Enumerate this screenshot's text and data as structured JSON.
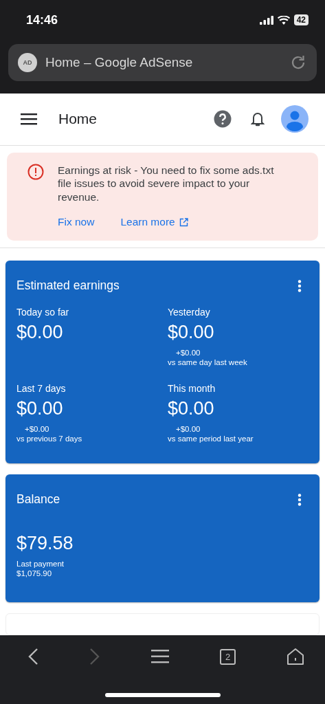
{
  "status_bar": {
    "time": "14:46",
    "battery": "42"
  },
  "browser": {
    "site_badge": "AD",
    "title": "Home – Google AdSense"
  },
  "app_bar": {
    "title": "Home"
  },
  "alert": {
    "message": "Earnings at risk - You need to fix some ads.txt file issues to avoid severe impact to your revenue.",
    "actions": [
      {
        "label": "Fix now",
        "kind": "plain"
      },
      {
        "label": "Learn more",
        "kind": "external"
      }
    ]
  },
  "earnings_card": {
    "title": "Estimated earnings",
    "metrics": [
      {
        "label": "Today so far",
        "value": "$0.00"
      },
      {
        "label": "Yesterday",
        "value": "$0.00",
        "change": "+$0.00",
        "comparison": "vs same day last week"
      },
      {
        "label": "Last 7 days",
        "value": "$0.00",
        "change": "+$0.00",
        "comparison": "vs previous 7 days"
      },
      {
        "label": "This month",
        "value": "$0.00",
        "change": "+$0.00",
        "comparison": "vs same period last year"
      }
    ]
  },
  "balance_card": {
    "title": "Balance",
    "amount": "$79.58",
    "last_payment_label": "Last payment",
    "last_payment": "$1,075.90"
  },
  "toolbar": {
    "back_disabled": false,
    "forward_disabled": true,
    "tab_count": "2"
  }
}
